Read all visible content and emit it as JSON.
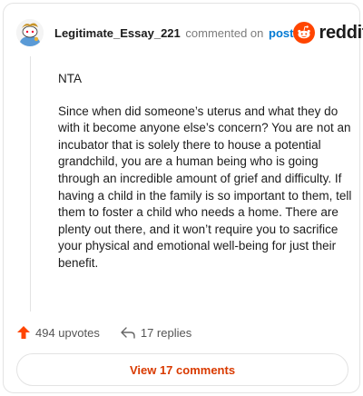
{
  "comment": {
    "author": "Legitimate_Essay_221",
    "verb": "commented on",
    "post_link": "post",
    "brand": "reddit",
    "paragraphs": [
      "NTA",
      "Since when did someone’s uterus and what they do with it become anyone else’s concern? You are not an incubator that is solely there to house a potential grandchild, you are a human being who is going through an incredible amount of grief and difficulty. If having a child in the family is so important to them, tell them to foster a child who needs a home. There are plenty out there, and it won’t require you to sacrifice your physical and emotional well-being for just their benefit."
    ]
  },
  "footer": {
    "upvotes": "494 upvotes",
    "replies": "17 replies",
    "view_comments": "View 17 comments"
  },
  "colors": {
    "accent": "#d93a00",
    "brand": "#ff4500",
    "link": "#0079d3"
  },
  "icons": {
    "avatar": "snoo-avatar",
    "brand": "reddit-logo",
    "upvote": "upvote-arrow-icon",
    "reply": "reply-arrow-icon"
  }
}
